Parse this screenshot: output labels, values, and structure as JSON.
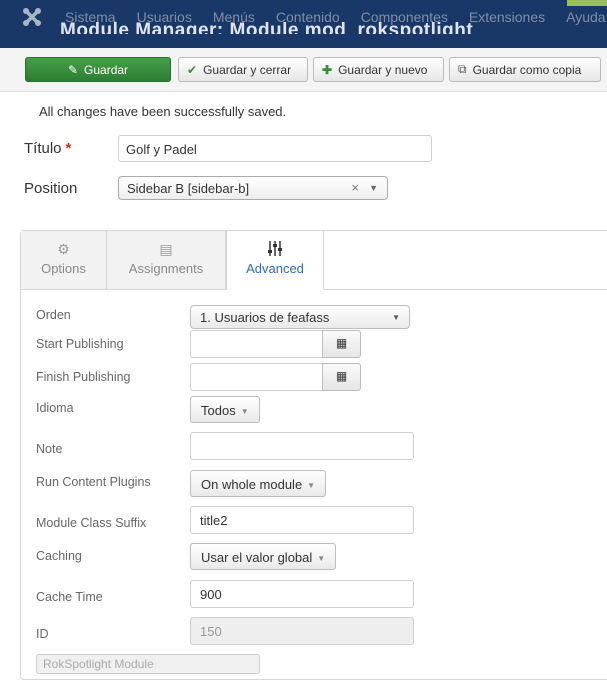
{
  "nav": {
    "menu": [
      "Sistema",
      "Usuarios",
      "Menús",
      "Contenido",
      "Componentes",
      "Extensiones",
      "Ayuda"
    ],
    "page_title": "Module Manager: Module mod_rokspotlight"
  },
  "toolbar": {
    "save": "Guardar",
    "save_close": "Guardar y cerrar",
    "save_new": "Guardar y nuevo",
    "save_copy": "Guardar como copia"
  },
  "message": "All changes have been successfully saved.",
  "title_field": {
    "label": "Título",
    "required_mark": "*",
    "value": "Golf y Padel"
  },
  "position_field": {
    "label": "Position",
    "value": "Sidebar B [sidebar-b]",
    "clear": "×"
  },
  "tabs": [
    {
      "label": "Options",
      "icon": "gear-icon",
      "active": false
    },
    {
      "label": "Assignments",
      "icon": "list-icon",
      "active": false
    },
    {
      "label": "Advanced",
      "icon": "sliders-icon",
      "active": true
    }
  ],
  "advanced": {
    "order": {
      "label": "Orden",
      "value": "1. Usuarios de feafass"
    },
    "start_publishing": {
      "label": "Start Publishing",
      "value": ""
    },
    "finish_publishing": {
      "label": "Finish Publishing",
      "value": ""
    },
    "language": {
      "label": "Idioma",
      "value": "Todos"
    },
    "note": {
      "label": "Note",
      "value": ""
    },
    "run_content_plugins": {
      "label": "Run Content Plugins",
      "value": "On whole module"
    },
    "module_class_suffix": {
      "label": "Module Class Suffix",
      "value": "title2"
    },
    "caching": {
      "label": "Caching",
      "value": "Usar el valor global"
    },
    "cache_time": {
      "label": "Cache Time",
      "value": "900"
    },
    "id": {
      "label": "ID",
      "value": "150"
    },
    "partial_button": "RokSpotlight Module"
  },
  "colors": {
    "nav_bg": "#1a3867",
    "save_green": "#2e7d32",
    "active_tab": "#2a6ebb",
    "required": "#c9302c"
  }
}
